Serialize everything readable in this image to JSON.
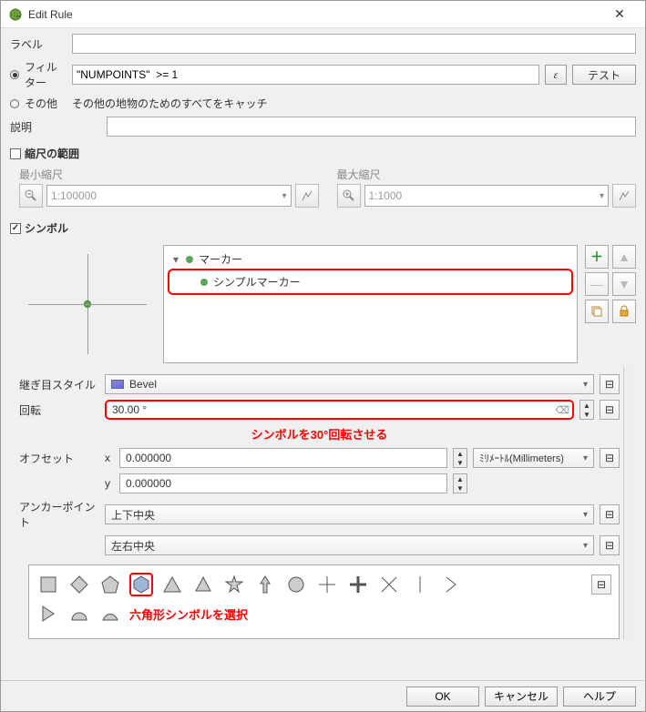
{
  "window": {
    "title": "Edit Rule"
  },
  "fields": {
    "label_label": "ラベル",
    "filter_label": "フィルター",
    "filter_value": "\"NUMPOINTS\"  >= 1",
    "epsilon": "ε",
    "test": "テスト",
    "else_label": "その他",
    "else_desc": "その他の地物のためのすべてをキャッチ",
    "desc_label": "説明"
  },
  "scale": {
    "group": "縮尺の範囲",
    "min_label": "最小縮尺",
    "max_label": "最大縮尺",
    "min_value": "1:100000",
    "max_value": "1:1000"
  },
  "symbol": {
    "group": "シンボル",
    "tree_root": "マーカー",
    "tree_child": "シンプルマーカー"
  },
  "props": {
    "join_label": "継ぎ目スタイル",
    "join_value": "Bevel",
    "rotation_label": "回転",
    "rotation_value": "30.00 °",
    "offset_label": "オフセット",
    "offset_x_label": "x",
    "offset_x_value": "0.000000",
    "offset_y_label": "y",
    "offset_y_value": "0.000000",
    "offset_unit": "ﾐﾘﾒｰﾄﾙ(Millimeters)",
    "anchor_label": "アンカーポイント",
    "anchor_v": "上下中央",
    "anchor_h": "左右中央"
  },
  "annotations": {
    "rotate": "シンボルを30°回転させる",
    "hexagon": "六角形シンボルを選択"
  },
  "buttons": {
    "ok": "OK",
    "cancel": "キャンセル",
    "help": "ヘルプ"
  }
}
